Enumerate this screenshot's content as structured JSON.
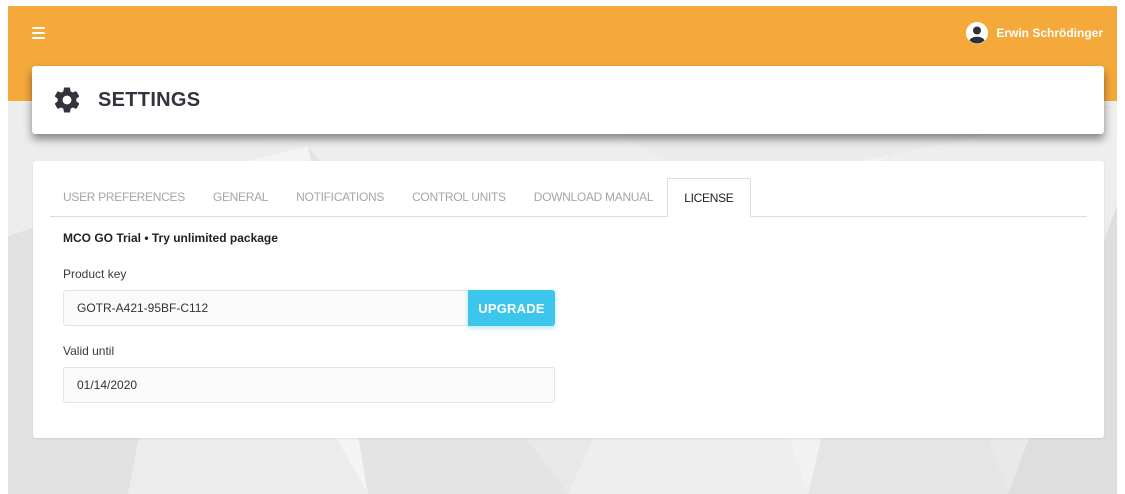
{
  "user": {
    "name": "Erwin Schrödinger",
    "avatar_icon": "user-circle-icon"
  },
  "header": {
    "title": "SETTINGS",
    "icon": "gear-icon"
  },
  "tabs": [
    {
      "label": "USER PREFERENCES",
      "active": false
    },
    {
      "label": "GENERAL",
      "active": false
    },
    {
      "label": "NOTIFICATIONS",
      "active": false
    },
    {
      "label": "CONTROL UNITS",
      "active": false
    },
    {
      "label": "DOWNLOAD MANUAL",
      "active": false
    },
    {
      "label": "LICENSE",
      "active": true
    }
  ],
  "license": {
    "trial_text": "MCO GO Trial • Try unlimited package",
    "product_key_label": "Product key",
    "product_key_value": "GOTR-A421-95BF-C112",
    "upgrade_label": "UPGRADE",
    "valid_until_label": "Valid until",
    "valid_until_value": "01/14/2020"
  },
  "colors": {
    "topbar": "#f5a93b",
    "accent_button": "#3dc6ec",
    "title_text": "#33333d"
  }
}
